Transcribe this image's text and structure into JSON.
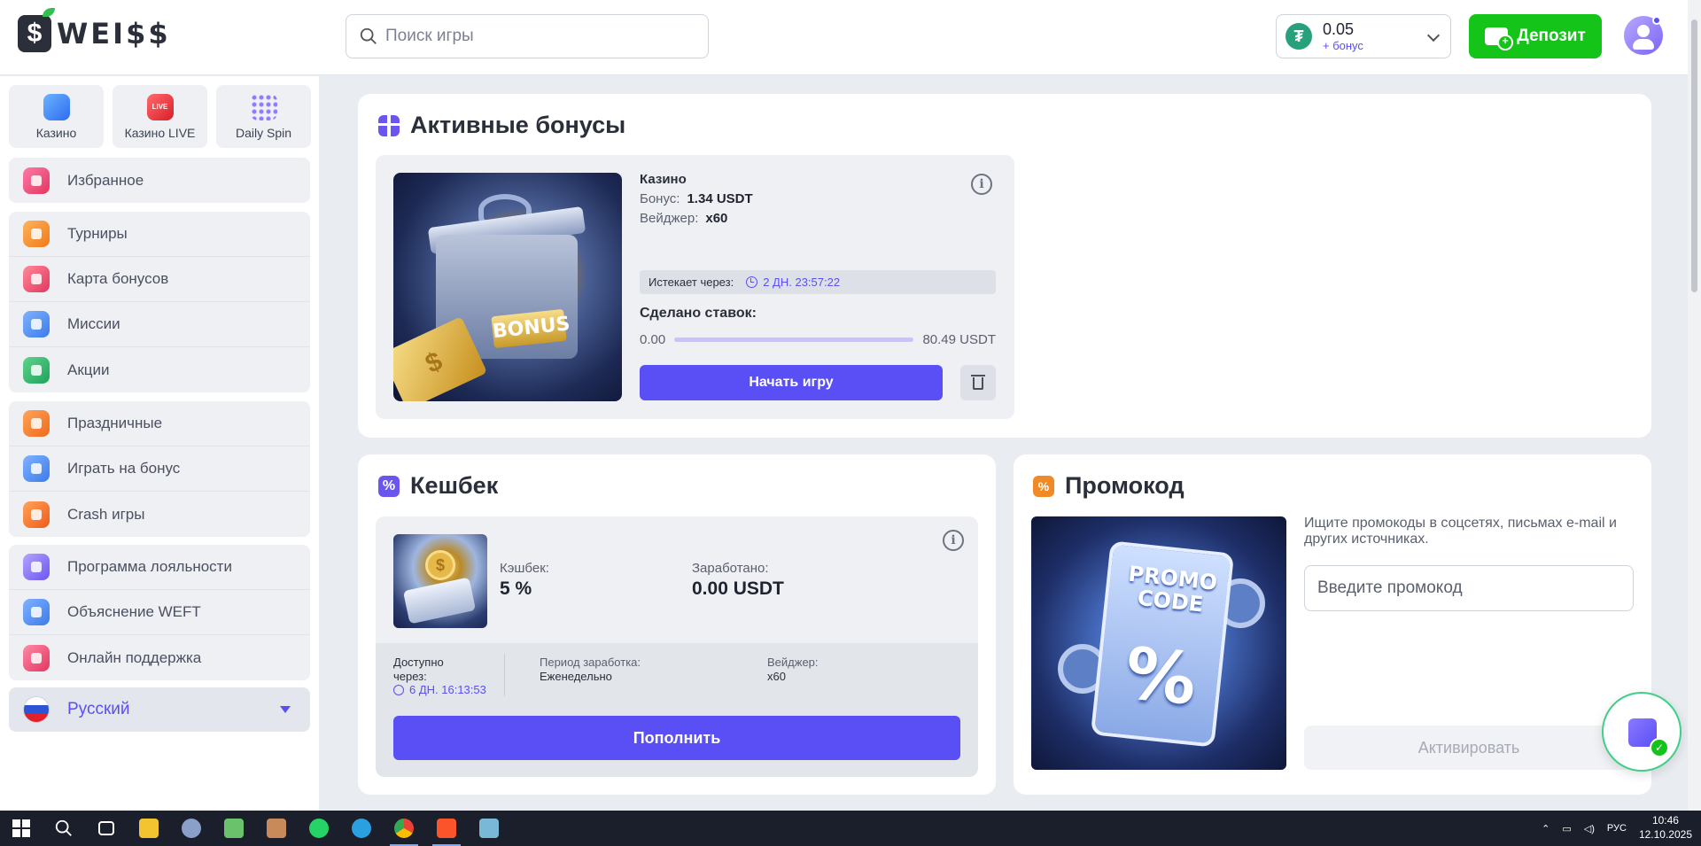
{
  "header": {
    "logo_text": "WEI$$",
    "logo_badge": "$",
    "search_placeholder": "Поиск игры",
    "balance_amount": "0.05",
    "balance_bonus": "+ бонус",
    "balance_currency_icon": "₮",
    "deposit_label": "Депозит"
  },
  "sidebar": {
    "tiles": [
      {
        "label": "Казино",
        "icon": "casino-icon"
      },
      {
        "label": "Казино LIVE",
        "icon": "live-icon",
        "badge": "LIVE"
      },
      {
        "label": "Daily Spin",
        "icon": "daily-spin-icon"
      }
    ],
    "favorites": {
      "label": "Избранное",
      "icon": "heart-icon"
    },
    "group1": [
      {
        "label": "Турниры",
        "icon": "trophy-icon"
      },
      {
        "label": "Карта бонусов",
        "icon": "bonus-map-icon"
      },
      {
        "label": "Миссии",
        "icon": "target-icon"
      },
      {
        "label": "Акции",
        "icon": "promo-icon"
      }
    ],
    "group2": [
      {
        "label": "Праздничные",
        "icon": "holiday-icon"
      },
      {
        "label": "Играть на бонус",
        "icon": "play-bonus-icon"
      },
      {
        "label": "Crash игры",
        "icon": "rocket-icon"
      }
    ],
    "group3": [
      {
        "label": "Программа лояльности",
        "icon": "loyalty-icon"
      },
      {
        "label": "Объяснение WEFT",
        "icon": "help-icon"
      },
      {
        "label": "Онлайн поддержка",
        "icon": "chat-icon"
      }
    ],
    "language": "Русский"
  },
  "active_bonuses": {
    "title": "Активные бонусы",
    "image_word": "BONUS",
    "category": "Казино",
    "bonus_label": "Бонус:",
    "bonus_value": "1.34 USDT",
    "wager_label": "Вейджер:",
    "wager_value": "x60",
    "expires_label": "Истекает через:",
    "expires_timer": "2 ДН.  23:57:22",
    "bets_label": "Сделано ставок:",
    "bets_current": "0.00",
    "bets_target": "80.49 USDT",
    "bets_progress": 0.0,
    "start_button": "Начать игру",
    "info_glyph": "i"
  },
  "cashback": {
    "title": "Кешбек",
    "title_icon_glyph": "%",
    "cashback_label": "Кэшбек:",
    "cashback_value": "5 %",
    "earned_label": "Заработано:",
    "earned_value": "0.00 USDT",
    "available_label": "Доступно через:",
    "available_timer": "6 ДН.  16:13:53",
    "period_label": "Период заработка:",
    "period_value": "Еженедельно",
    "wager_label": "Вейджер:",
    "wager_value": "x60",
    "refill_button": "Пополнить",
    "info_glyph": "i",
    "coin_glyph": "$"
  },
  "promocode": {
    "title": "Промокод",
    "title_icon_glyph": "%",
    "image_line1": "PROMO",
    "image_line2": "CODE",
    "image_pct": "%",
    "hint": "Ищите промокоды в соцсетях, письмах e-mail и других источниках.",
    "input_placeholder": "Введите промокод",
    "activate_button": "Активировать"
  },
  "taskbar": {
    "time": "10:46",
    "date": "12.10.2025",
    "lang": "РУС",
    "apps": [
      "start-icon",
      "search-icon",
      "task-view-icon",
      "file-explorer-icon",
      "app-icon",
      "notepad-icon",
      "photo-app-icon",
      "whatsapp-icon",
      "telegram-icon",
      "chrome-icon",
      "brave-icon",
      "notes-icon"
    ]
  },
  "colors": {
    "accent": "#5a4ff5",
    "deposit_green": "#14c419",
    "background": "#e9ecf1"
  }
}
